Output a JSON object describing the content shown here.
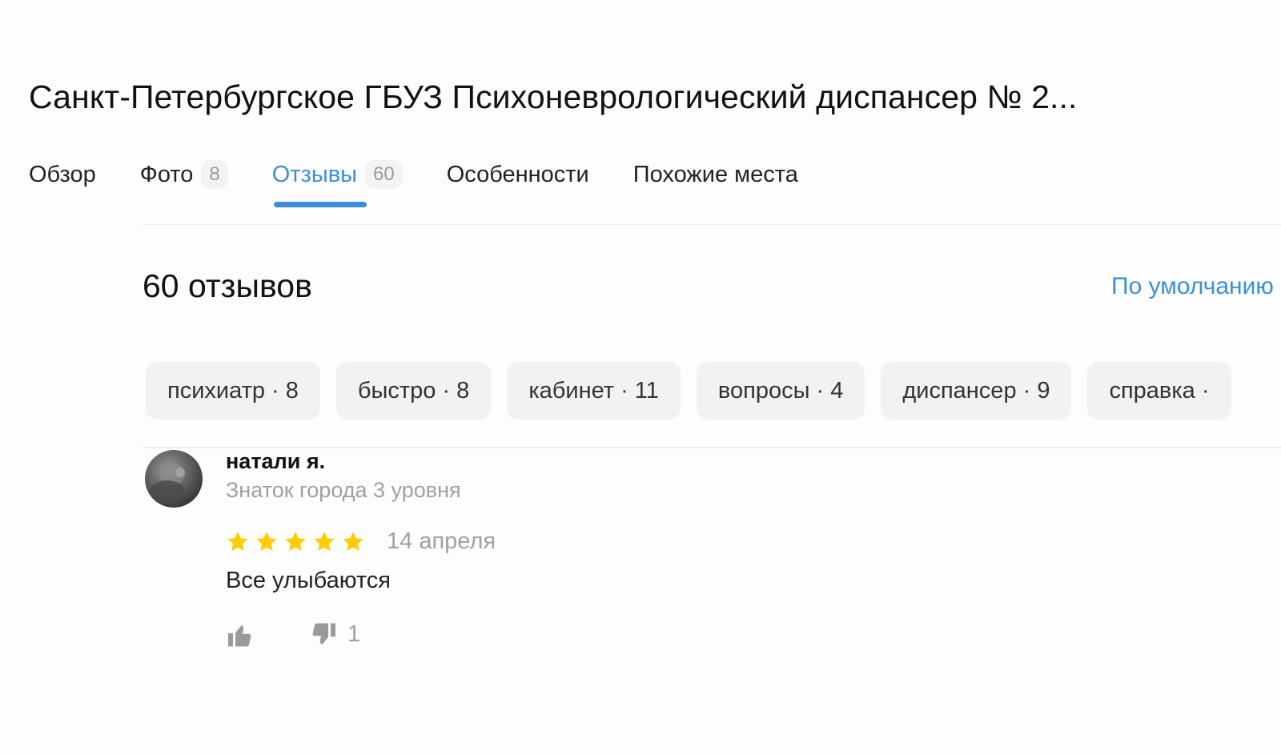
{
  "header": {
    "title": "Санкт-Петербургское ГБУЗ Психоневрологический диспансер № 2..."
  },
  "tabs": [
    {
      "label": "Обзор",
      "count": null,
      "active": false
    },
    {
      "label": "Фото",
      "count": "8",
      "active": false
    },
    {
      "label": "Отзывы",
      "count": "60",
      "active": true
    },
    {
      "label": "Особенности",
      "count": null,
      "active": false
    },
    {
      "label": "Похожие места",
      "count": null,
      "active": false
    }
  ],
  "reviews": {
    "count_label": "60 отзывов",
    "sort_label": "По умолчанию",
    "chips": [
      "психиатр · 8",
      "быстро · 8",
      "кабинет · 11",
      "вопросы · 4",
      "диспансер · 9",
      "справка · "
    ],
    "items": [
      {
        "author": "натали я.",
        "level": "Знаток города 3 уровня",
        "rating": 5,
        "date": "14 апреля",
        "text": "Все улыбаются",
        "likes": "",
        "dislikes": "1"
      }
    ]
  },
  "colors": {
    "accent": "#3c8fd6",
    "star": "#ffcc00",
    "muted": "#a0a0a0",
    "chip_bg": "#f2f2f2"
  },
  "icons": {
    "like": "thumbs-up-icon",
    "dislike": "thumbs-down-icon",
    "star": "star-icon"
  }
}
